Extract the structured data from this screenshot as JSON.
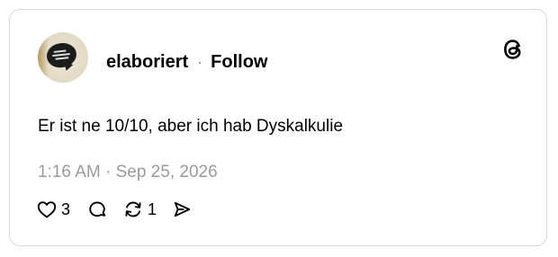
{
  "post": {
    "username": "elaboriert",
    "separator": "·",
    "follow_label": "Follow",
    "text": "Er ist ne 10/10, aber ich hab Dyskalkulie",
    "timestamp": "1:16 AM · Sep 25, 2026"
  },
  "actions": {
    "like_count": "3",
    "repost_count": "1"
  },
  "icons": {
    "logo": "threads-logo-icon",
    "like": "heart-icon",
    "reply": "comment-bubble-icon",
    "repost": "repost-icon",
    "share": "send-icon"
  },
  "colors": {
    "text": "#000000",
    "muted": "#9a9a9a",
    "border": "#d9d9d9"
  }
}
